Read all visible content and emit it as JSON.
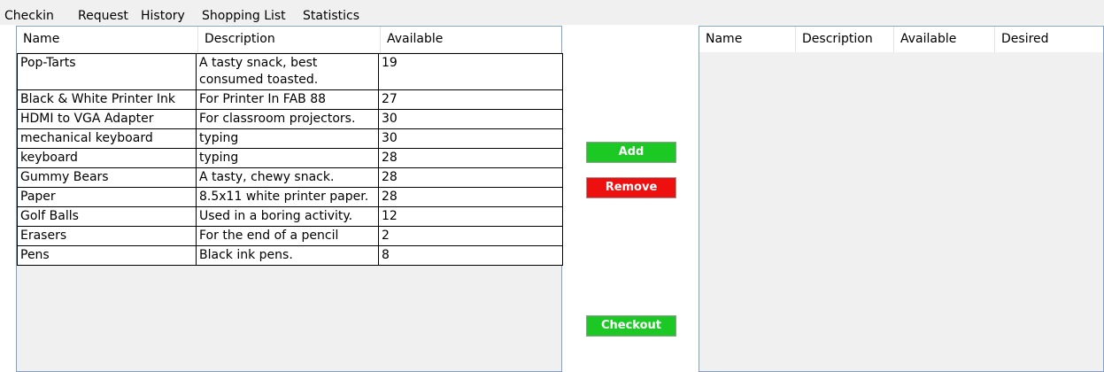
{
  "menu": [
    "Checkin",
    "Request",
    "History",
    "Shopping List",
    "Statistics"
  ],
  "inventory": {
    "columns": [
      "Name",
      "Description",
      "Available"
    ],
    "rows": [
      [
        "Pop-Tarts",
        "A tasty snack, best consumed toasted.",
        "19"
      ],
      [
        "Black & White Printer Ink",
        "For Printer In FAB 88",
        "27"
      ],
      [
        "HDMI to VGA Adapter",
        "For classroom projectors.",
        "30"
      ],
      [
        "mechanical keyboard",
        "typing",
        "30"
      ],
      [
        "keyboard",
        "typing",
        "28"
      ],
      [
        "Gummy Bears",
        "A tasty, chewy snack.",
        "28"
      ],
      [
        "Paper",
        "8.5x11 white printer paper.",
        "28"
      ],
      [
        "Golf Balls",
        "Used in a boring activity.",
        "12"
      ],
      [
        "Erasers",
        "For the end of a pencil",
        "2"
      ],
      [
        "Pens",
        "Black ink pens.",
        "8"
      ]
    ]
  },
  "actions": {
    "add_label": "Add",
    "remove_label": "Remove",
    "checkout_label": "Checkout"
  },
  "cart": {
    "columns": [
      "Name",
      "Description",
      "Available",
      "Desired"
    ],
    "rows": []
  }
}
